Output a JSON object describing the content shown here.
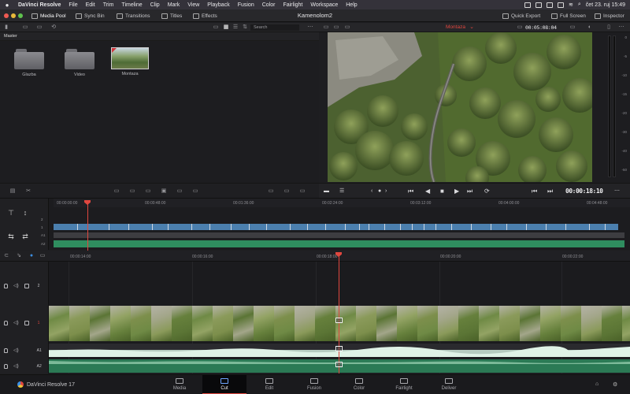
{
  "menubar": {
    "items": [
      "DaVinci Resolve",
      "File",
      "Edit",
      "Trim",
      "Timeline",
      "Clip",
      "Mark",
      "View",
      "Playback",
      "Fusion",
      "Color",
      "Fairlight",
      "Workspace",
      "Help"
    ],
    "clock": "čet 23. ruj  15:49"
  },
  "toolbar": {
    "media_pool": "Media Pool",
    "sync_bin": "Sync Bin",
    "transitions": "Transitions",
    "titles": "Titles",
    "effects": "Effects",
    "project_title": "Kamenolom2",
    "quick_export": "Quick Export",
    "full_screen": "Full Screen",
    "inspector": "Inspector"
  },
  "media_pool": {
    "search_placeholder": "Search",
    "bin_label": "Master",
    "items": [
      {
        "name": "Glazba",
        "kind": "folder"
      },
      {
        "name": "Video",
        "kind": "folder"
      },
      {
        "name": "Montaza",
        "kind": "timeline"
      }
    ]
  },
  "viewer": {
    "timeline_name": "Montaza",
    "duration_tc": "00:05:08:04",
    "current_tc": "00:00:18:10",
    "meter_scale": [
      "0",
      "-5",
      "-10",
      "-15",
      "-20",
      "-30",
      "-40",
      "-50"
    ]
  },
  "upper_timeline": {
    "ruler": [
      "00:00:00:00",
      "00:00:48:00",
      "00:01:36:00",
      "00:02:24:00",
      "00:03:12:00",
      "00:04:00:00",
      "00:04:48:00"
    ],
    "tracks": [
      "2",
      "1",
      "A1",
      "A2"
    ]
  },
  "lower_timeline": {
    "ruler": [
      "00:00:14:00",
      "00:00:16:00",
      "00:00:18:00",
      "00:00:20:00",
      "00:00:22:00"
    ],
    "tracks": [
      "2",
      "1",
      "A1",
      "A2"
    ]
  },
  "pagebar": {
    "brand": "DaVinci Resolve 17",
    "tabs": [
      "Media",
      "Cut",
      "Edit",
      "Fusion",
      "Color",
      "Fairlight",
      "Deliver"
    ],
    "active_tab": "Cut"
  },
  "colors": {
    "accent_red": "#e0473f",
    "video_track_blue": "#4b7fae",
    "audio_track_green": "#2f8d5f"
  }
}
